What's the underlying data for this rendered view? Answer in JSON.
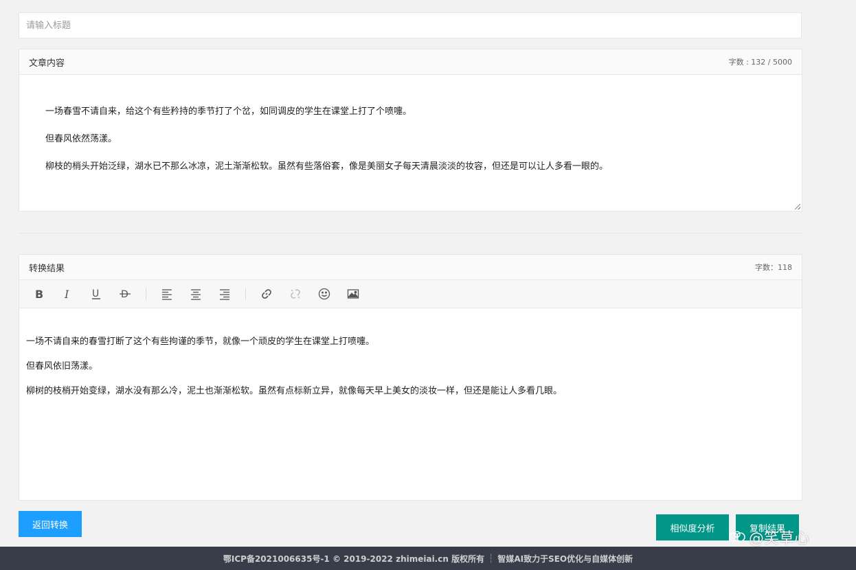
{
  "title_input": {
    "placeholder": "请输入标题",
    "value": ""
  },
  "source": {
    "label": "文章内容",
    "count": "字数 : 132 / 5000",
    "paragraphs": [
      "一场春雪不请自来，给这个有些矜持的季节打了个岔，如同调皮的学生在课堂上打了个喷嚏。",
      "但春风依然荡漾。",
      "柳枝的梢头开始泛绿，湖水已不那么冰凉，泥土渐渐松软。虽然有些落俗套，像是美丽女子每天清晨淡淡的妆容，但还是可以让人多看一眼的。"
    ]
  },
  "result": {
    "label": "转换结果",
    "count": "字数：118",
    "toolbar_icons": [
      "bold-icon",
      "italic-icon",
      "underline-icon",
      "strikethrough-icon",
      "align-left-icon",
      "align-center-icon",
      "align-right-icon",
      "link-icon",
      "unlink-icon",
      "emoji-icon",
      "image-icon"
    ],
    "paragraphs": [
      "一场不请自来的春雪打断了这个有些拘谨的季节，就像一个顽皮的学生在课堂上打喷嚏。",
      "但春风依旧荡漾。",
      "柳树的枝梢开始变绿，湖水没有那么冷，泥土也渐渐松软。虽然有点标新立异，就像每天早上美女的淡妆一样，但还是能让人多看几眼。"
    ]
  },
  "buttons": {
    "back": "返回转换",
    "similarity": "相似度分析",
    "copy": "复制结果"
  },
  "watermark": "@笑草心",
  "footer": {
    "icp": "鄂ICP备2021006635号-1 © 2019-2022 zhimeiai.cn 版权所有",
    "slogan": "智媒AI致力于SEO优化与自媒体创新"
  },
  "colors": {
    "blue_button": "#1e9fff",
    "green_button": "#009688",
    "footer_bg": "#393d49"
  }
}
